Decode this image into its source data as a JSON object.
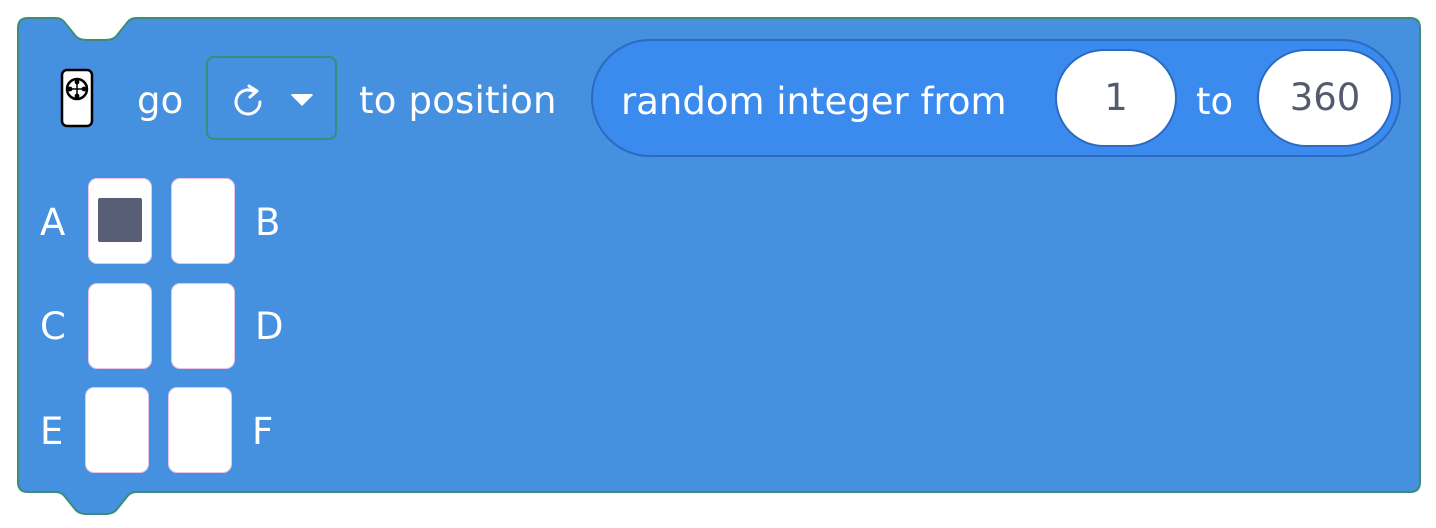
{
  "block": {
    "color": "#4690e0",
    "border_color": "#3a8d7a",
    "reporter_color": "#3b8bef",
    "go_label": "go",
    "direction_icon": "rotate-clockwise-icon",
    "to_position_label": "to position",
    "reporter": {
      "label_from": "random integer from",
      "value_from": "1",
      "label_to": "to",
      "value_to": "360"
    },
    "ports": [
      {
        "label": "A",
        "selected": true
      },
      {
        "label": "B",
        "selected": false
      },
      {
        "label": "C",
        "selected": false
      },
      {
        "label": "D",
        "selected": false
      },
      {
        "label": "E",
        "selected": false
      },
      {
        "label": "F",
        "selected": false
      }
    ]
  }
}
